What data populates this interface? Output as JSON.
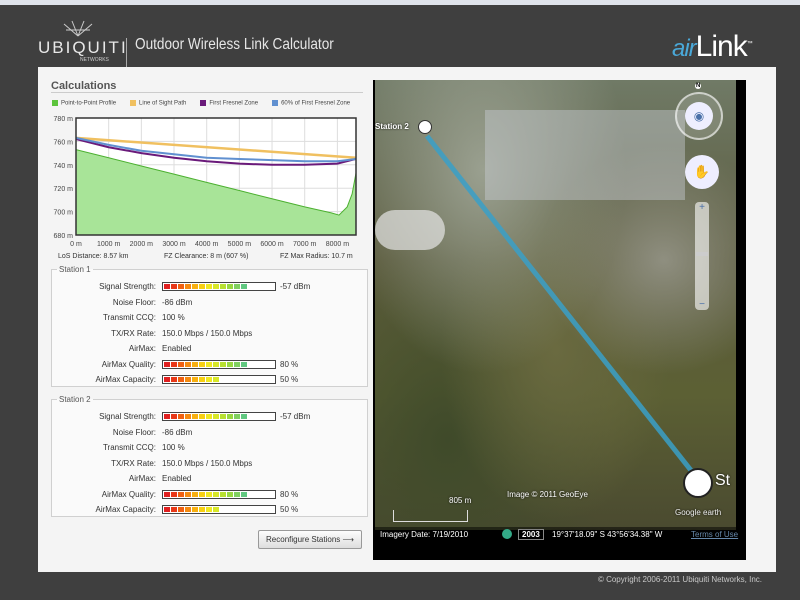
{
  "header": {
    "brand": "UBIQUITI",
    "brand_sub": "NETWORKS",
    "title": "Outdoor Wireless Link Calculator",
    "product_prefix": "air",
    "product_name": "Link",
    "tm": "™"
  },
  "calculations": {
    "title": "Calculations",
    "legend": [
      {
        "label": "Point-to-Point Profile",
        "color": "#5cc43c"
      },
      {
        "label": "Line of Sight Path",
        "color": "#f0c060"
      },
      {
        "label": "First Fresnel Zone",
        "color": "#6a1a7a"
      },
      {
        "label": "60% of First Fresnel Zone",
        "color": "#6090d0"
      }
    ],
    "los_distance": "LoS Distance:  8.57 km",
    "fz_clearance": "FZ Clearance:  8 m  (607 %)",
    "fz_max_radius": "FZ Max Radius:  10.7 m"
  },
  "chart_data": {
    "type": "area",
    "title": "",
    "xlabel": "",
    "ylabel": "",
    "xlim": [
      0,
      8570
    ],
    "ylim": [
      680,
      780
    ],
    "yticks": [
      "680 m",
      "700 m",
      "720 m",
      "740 m",
      "760 m",
      "780 m"
    ],
    "xticks": [
      "0 m",
      "1000 m",
      "2000 m",
      "3000 m",
      "4000 m",
      "5000 m",
      "6000 m",
      "7000 m",
      "8000 m"
    ],
    "series": [
      {
        "name": "Point-to-Point Profile",
        "x": [
          0,
          1000,
          2000,
          3000,
          4000,
          5000,
          6000,
          7000,
          7800,
          8050,
          8300,
          8450,
          8570
        ],
        "y": [
          753,
          746,
          739,
          732,
          725,
          718,
          711,
          704,
          699,
          697,
          704,
          715,
          733
        ]
      },
      {
        "name": "Line of Sight Path",
        "x": [
          0,
          8570
        ],
        "y": [
          763,
          746
        ]
      },
      {
        "name": "First Fresnel Zone",
        "x": [
          0,
          1000,
          2000,
          3000,
          4000,
          5000,
          6000,
          7000,
          8000,
          8570
        ],
        "y": [
          762,
          755,
          750,
          746,
          743,
          741,
          740,
          740,
          741,
          745
        ]
      },
      {
        "name": "60% of First Fresnel Zone",
        "x": [
          0,
          1000,
          2000,
          3000,
          4000,
          5000,
          6000,
          7000,
          8000,
          8570
        ],
        "y": [
          763,
          757,
          752,
          749,
          746,
          745,
          744,
          743,
          743,
          745
        ]
      }
    ]
  },
  "stations": [
    {
      "title": "Station 1",
      "signal_label": "Signal Strength:",
      "signal": "-57 dBm",
      "signal_pct": 80,
      "noise_label": "Noise Floor:",
      "noise": "-86 dBm",
      "ccq_label": "Transmit CCQ:",
      "ccq": "100 %",
      "rate_label": "TX/RX Rate:",
      "rate": "150.0 Mbps / 150.0 Mbps",
      "airmax_label": "AirMax:",
      "airmax": "Enabled",
      "quality_label": "AirMax Quality:",
      "quality": "80 %",
      "quality_pct": 80,
      "capacity_label": "AirMax Capacity:",
      "capacity": "50 %",
      "capacity_pct": 50
    },
    {
      "title": "Station 2",
      "signal_label": "Signal Strength:",
      "signal": "-57 dBm",
      "signal_pct": 80,
      "noise_label": "Noise Floor:",
      "noise": "-86 dBm",
      "ccq_label": "Transmit CCQ:",
      "ccq": "100 %",
      "rate_label": "TX/RX Rate:",
      "rate": "150.0 Mbps / 150.0 Mbps",
      "airmax_label": "AirMax:",
      "airmax": "Enabled",
      "quality_label": "AirMax Quality:",
      "quality": "80 %",
      "quality_pct": 80,
      "capacity_label": "AirMax Capacity:",
      "capacity": "50 %",
      "capacity_pct": 50
    }
  ],
  "reconfigure_label": "Reconfigure Stations ⟶",
  "map": {
    "station2_label": "Station 2",
    "station1_label": "St",
    "north": "N",
    "scale": "805 m",
    "image_credit": "Image © 2011 GeoEye",
    "google": "Google earth",
    "imagery_date": "Imagery Date: 7/19/2010",
    "year": "2003",
    "coords": "19°37'18.09\" S  43°56'34.38\" W",
    "terms": "Terms of Use",
    "link_color": "#3aa0c8"
  },
  "footer": {
    "copyright": "© Copyright 2006-2011 Ubiquiti Networks, Inc."
  }
}
